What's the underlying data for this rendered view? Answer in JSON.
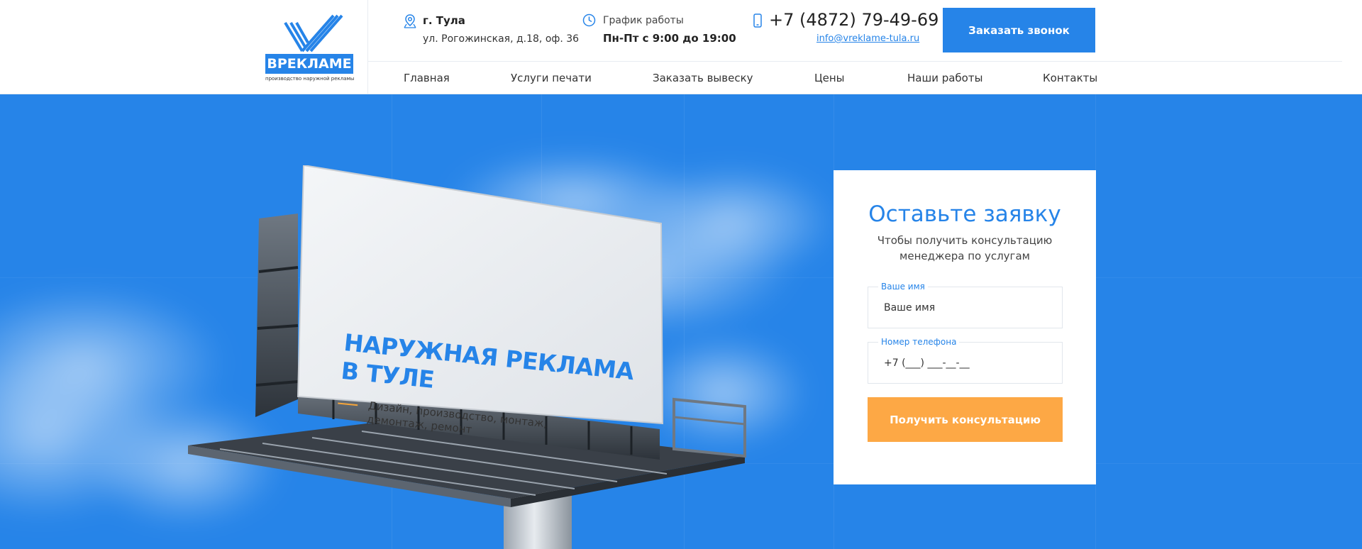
{
  "logo": {
    "word": "ВРЕКЛАМЕ",
    "tagline": "производство наружной рекламы",
    "color": "#2684e8"
  },
  "location": {
    "icon": "map-pin-icon",
    "city": "г. Тула",
    "address": "ул. Рогожинская, д.18, оф. 36"
  },
  "schedule": {
    "icon": "clock-icon",
    "label": "График работы",
    "value": "Пн-Пт с 9:00 до 19:00"
  },
  "contact": {
    "icon": "phone-icon",
    "phone": "+7 (4872) 79-49-69",
    "email": "info@vreklame-tula.ru"
  },
  "callback_button": "Заказать звонок",
  "nav": [
    "Главная",
    "Услуги печати",
    "Заказать вывеску",
    "Цены",
    "Наши работы",
    "Контакты"
  ],
  "hero": {
    "billboard_title_line1": "НАРУЖНАЯ РЕКЛАМА",
    "billboard_title_line2": "В ТУЛЕ",
    "billboard_subtitle": "Дизайн, производство, монтаж, демонтаж, ремонт"
  },
  "form": {
    "title": "Оставьте заявку",
    "subtitle": "Чтобы получить консультацию менеджера по услугам",
    "name_label": "Ваше имя",
    "name_placeholder": "Ваше имя",
    "phone_label": "Номер телефона",
    "phone_placeholder": "+7 (___) ___-__-__",
    "submit": "Получить консультацию"
  },
  "colors": {
    "primary": "#2684e8",
    "accent": "#fda845",
    "text": "#222222"
  }
}
